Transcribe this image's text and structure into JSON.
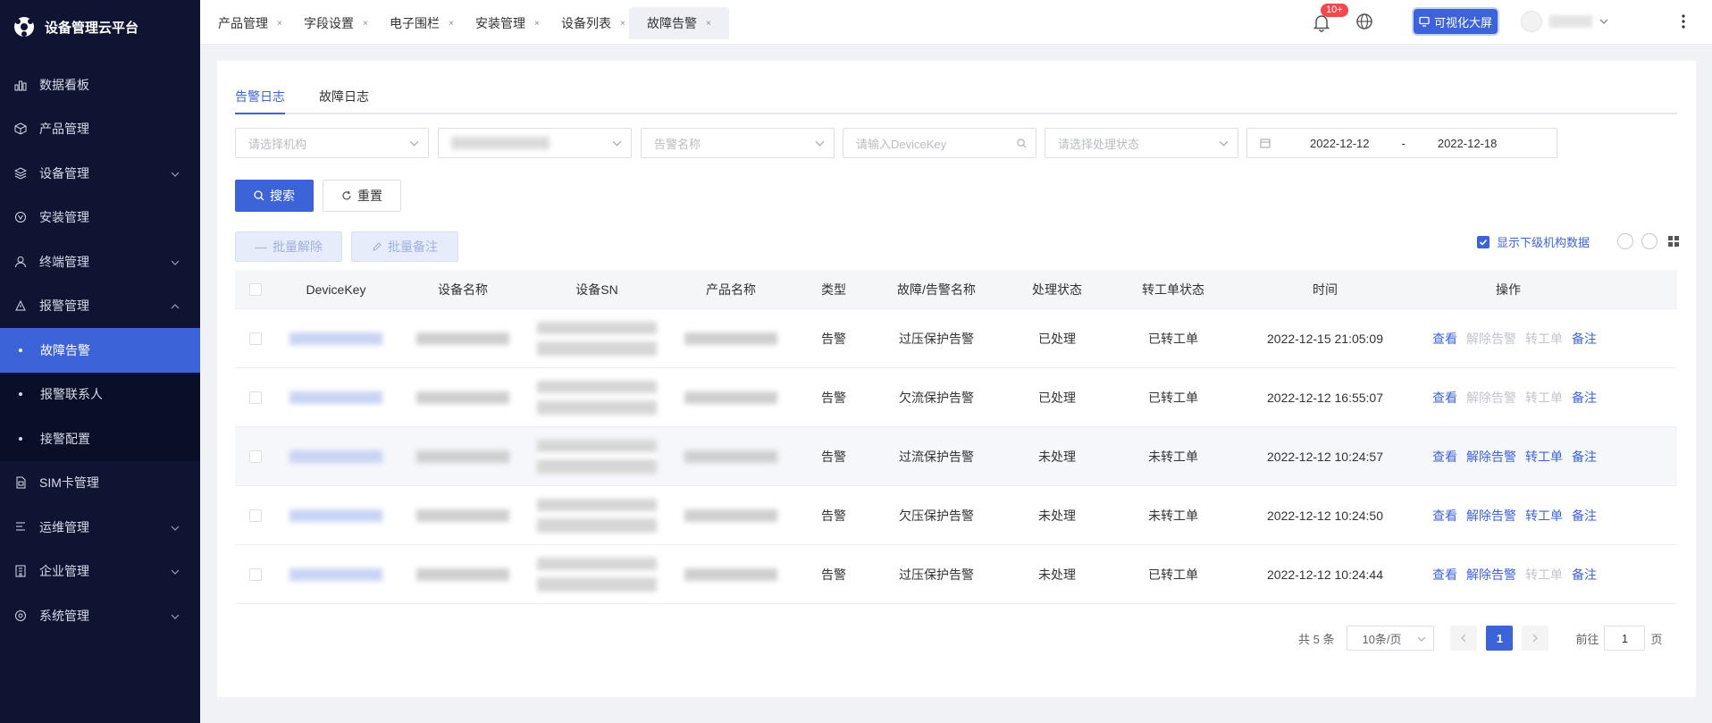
{
  "app": {
    "title": "设备管理云平台"
  },
  "sidebar": {
    "items": [
      {
        "label": "数据看板",
        "icon": "bar-chart-icon",
        "has_children": false
      },
      {
        "label": "产品管理",
        "icon": "cube-icon",
        "has_children": false
      },
      {
        "label": "设备管理",
        "icon": "layers-icon",
        "has_children": true
      },
      {
        "label": "安装管理",
        "icon": "install-icon",
        "has_children": false
      },
      {
        "label": "终端管理",
        "icon": "user-icon",
        "has_children": true
      },
      {
        "label": "报警管理",
        "icon": "alarm-icon",
        "has_children": true,
        "expanded": true
      }
    ],
    "sub_items": [
      {
        "label": "故障告警",
        "active": true
      },
      {
        "label": "报警联系人",
        "active": false
      },
      {
        "label": "接警配置",
        "active": false
      }
    ],
    "items_after": [
      {
        "label": "SIM卡管理",
        "icon": "sim-card-icon",
        "has_children": false
      },
      {
        "label": "运维管理",
        "icon": "wrench-icon",
        "has_children": true
      },
      {
        "label": "企业管理",
        "icon": "building-icon",
        "has_children": true
      },
      {
        "label": "系统管理",
        "icon": "settings-icon",
        "has_children": true
      }
    ]
  },
  "topbar": {
    "tabs": [
      "产品管理",
      "字段设置",
      "电子围栏",
      "安装管理",
      "设备列表",
      "故障告警"
    ],
    "active_tab": "故障告警",
    "notification_badge": "10+",
    "big_screen_label": "可视化大屏"
  },
  "subtabs": {
    "items": [
      "告警日志",
      "故障日志"
    ],
    "active": "告警日志"
  },
  "filters": {
    "org_placeholder": "请选择机构",
    "alarm_name_placeholder": "告警名称",
    "devicekey_placeholder": "请输入DeviceKey",
    "status_placeholder": "请选择处理状态",
    "date_start": "2022-12-12",
    "date_sep": "-",
    "date_end": "2022-12-18"
  },
  "actions": {
    "search_label": "搜索",
    "reset_label": "重置",
    "batch_release_label": "批量解除",
    "batch_note_label": "批量备注",
    "show_sub_org_label": "显示下级机构数据"
  },
  "table": {
    "headers": [
      "DeviceKey",
      "设备名称",
      "设备SN",
      "产品名称",
      "类型",
      "故障/告警名称",
      "处理状态",
      "转工单状态",
      "时间",
      "操作"
    ],
    "op_labels": {
      "view": "查看",
      "release": "解除告警",
      "ticket": "转工单",
      "note": "备注"
    },
    "rows": [
      {
        "type": "告警",
        "alarm_name": "过压保护告警",
        "status": "已处理",
        "ticket_status": "已转工单",
        "time": "2022-12-15 21:05:09",
        "release_enabled": false,
        "ticket_enabled": false
      },
      {
        "type": "告警",
        "alarm_name": "欠流保护告警",
        "status": "已处理",
        "ticket_status": "已转工单",
        "time": "2022-12-12 16:55:07",
        "release_enabled": false,
        "ticket_enabled": false
      },
      {
        "type": "告警",
        "alarm_name": "过流保护告警",
        "status": "未处理",
        "ticket_status": "未转工单",
        "time": "2022-12-12 10:24:57",
        "release_enabled": true,
        "ticket_enabled": true
      },
      {
        "type": "告警",
        "alarm_name": "欠压保护告警",
        "status": "未处理",
        "ticket_status": "未转工单",
        "time": "2022-12-12 10:24:50",
        "release_enabled": true,
        "ticket_enabled": true
      },
      {
        "type": "告警",
        "alarm_name": "过压保护告警",
        "status": "未处理",
        "ticket_status": "已转工单",
        "time": "2022-12-12 10:24:44",
        "release_enabled": true,
        "ticket_enabled": false
      }
    ]
  },
  "pagination": {
    "total_label": "共 5 条",
    "page_size_label": "10条/页",
    "current_page": "1",
    "goto_prefix": "前往",
    "goto_value": "1",
    "goto_suffix": "页"
  },
  "colors": {
    "primary": "#3d63d8",
    "sidebar_bg": "#0f1433",
    "badge": "#f5484a"
  }
}
